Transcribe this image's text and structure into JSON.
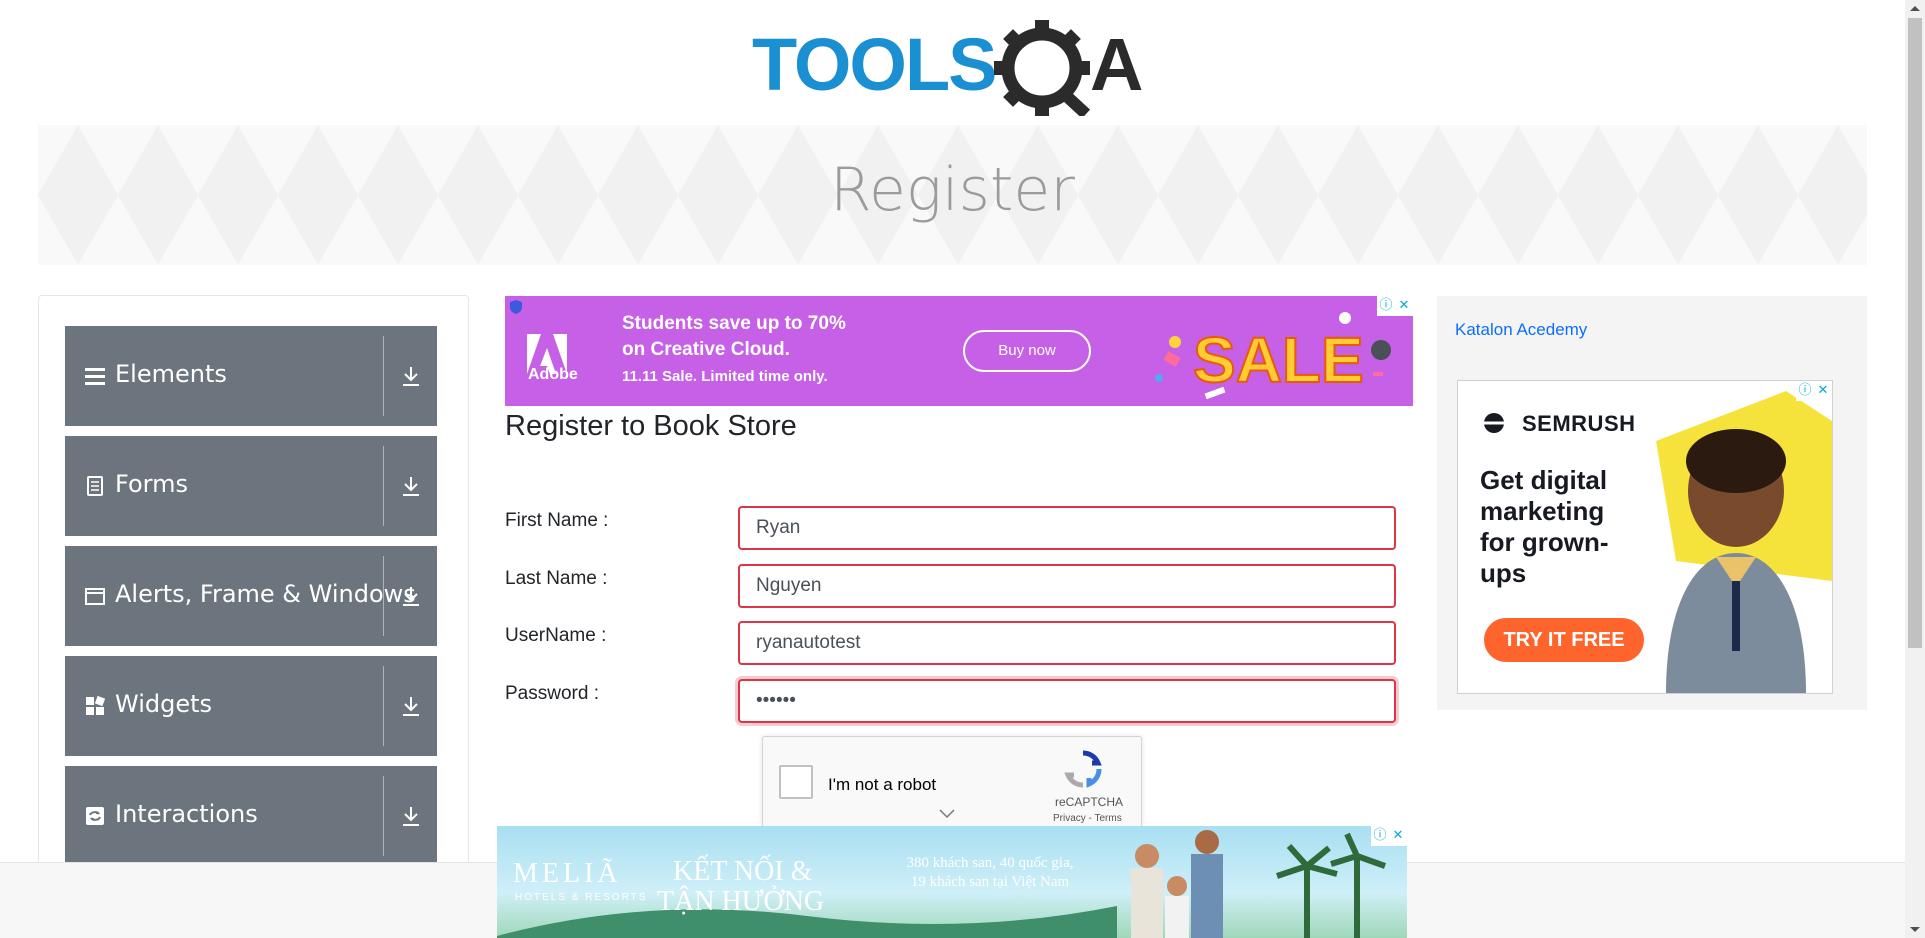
{
  "site": {
    "logo_alt": "TOOLSQA",
    "page_title": "Register"
  },
  "sidebar": {
    "items": [
      {
        "label": "Elements",
        "icon": "hamburger-icon"
      },
      {
        "label": "Forms",
        "icon": "document-icon"
      },
      {
        "label": "Alerts, Frame & Windows",
        "icon": "window-icon"
      },
      {
        "label": "Widgets",
        "icon": "grid-icon"
      },
      {
        "label": "Interactions",
        "icon": "refresh-icon"
      }
    ]
  },
  "ad_top": {
    "brand": "Adobe",
    "line1": "Students save up to 70%",
    "line2": "on Creative Cloud.",
    "line3": "11.11 Sale. Limited time only.",
    "button": "Buy now",
    "sale": "SALE",
    "info_glyph": "ⓘ",
    "close_glyph": "✕"
  },
  "form": {
    "title": "Register to Book Store",
    "fields": [
      {
        "label": "First Name :",
        "value": "Ryan"
      },
      {
        "label": "Last Name :",
        "value": "Nguyen"
      },
      {
        "label": "UserName :",
        "value": "ryanautotest"
      },
      {
        "label": "Password :",
        "value": "••••••"
      }
    ]
  },
  "captcha": {
    "text": "I'm not a robot",
    "brand": "reCAPTCHA",
    "links": "Privacy - Terms"
  },
  "right_ad": {
    "broken_image_alt": "Katalon Acedemy",
    "brand": "SEMRUSH",
    "headline": "Get digital marketing for grown-ups",
    "button": "TRY IT FREE",
    "info_glyph": "ⓘ",
    "close_glyph": "✕"
  },
  "ad_bottom": {
    "brand": "MELIÃ",
    "brand_sub": "HOTELS & RESORTS",
    "tag1": "KẾT NỐI &",
    "tag2": "TẬN HƯỞNG",
    "info": "380 khách san, 40 quốc gia, 19 khách san tại Việt Nam",
    "info_glyph": "ⓘ",
    "close_glyph": "✕"
  },
  "colors": {
    "menu_bg": "#6c757d",
    "invalid_border": "#dc3545",
    "logo_blue": "#1a8fd1",
    "logo_dark": "#2b2b2b",
    "adobe_purple": "#c660e6",
    "semrush_orange": "#ff642d"
  }
}
